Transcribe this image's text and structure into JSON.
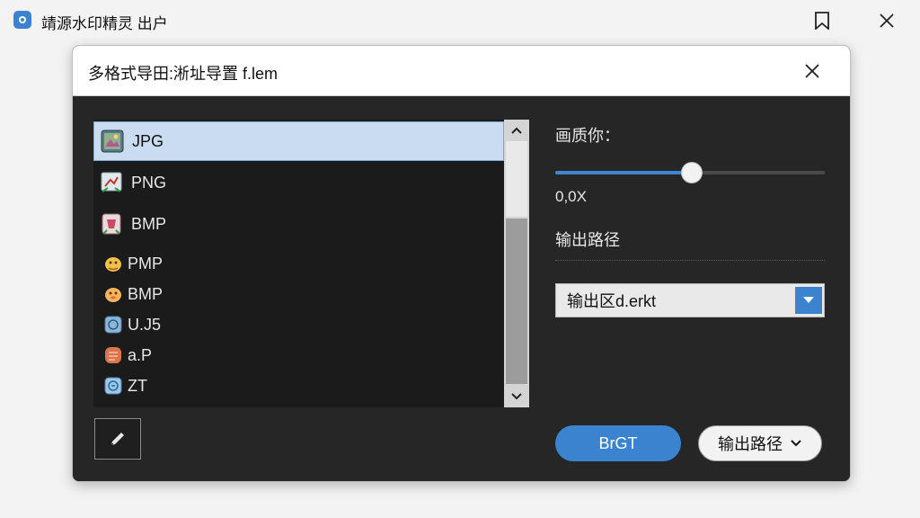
{
  "app": {
    "title": "靖源水印精灵 出户",
    "icon": "app-logo-icon"
  },
  "window_controls": {
    "bookmark_icon": "bookmark-icon",
    "close_icon": "close-icon"
  },
  "dialog": {
    "title": "多格式导田:淅址导置 f.lem",
    "close_icon": "close-icon"
  },
  "formats": {
    "items": [
      {
        "label": "JPG",
        "icon": "jpg-file-icon",
        "selected": true
      },
      {
        "label": "PNG",
        "icon": "png-file-icon",
        "selected": false
      },
      {
        "label": "BMP",
        "icon": "bmp-file-icon",
        "selected": false
      },
      {
        "label": "PMP",
        "icon": "pmp-file-icon",
        "selected": false
      },
      {
        "label": "BMP",
        "icon": "bmp-file-icon-2",
        "selected": false
      },
      {
        "label": "U.J5",
        "icon": "uj5-file-icon",
        "selected": false
      },
      {
        "label": "a.P",
        "icon": "ap-file-icon",
        "selected": false
      },
      {
        "label": "ZT",
        "icon": "zt-file-icon",
        "selected": false
      }
    ]
  },
  "quality": {
    "label": "画质你：",
    "value_text": "0,0X",
    "slider_fraction": 0.505
  },
  "output": {
    "label": "输出路径",
    "select_value": "输出区d.erkt"
  },
  "buttons": {
    "primary": "BrGT",
    "secondary": "输出路径"
  },
  "colors": {
    "accent": "#3c83cf",
    "selection": "#c9dcf0",
    "dialog_bg": "#262626"
  }
}
